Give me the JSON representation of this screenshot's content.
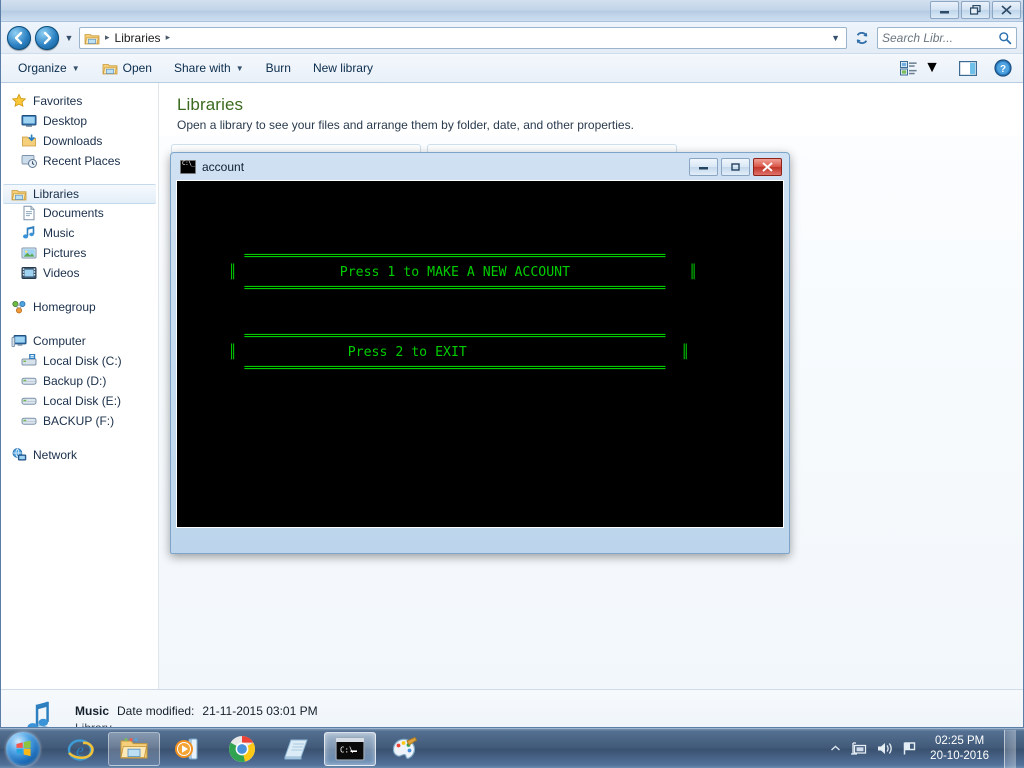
{
  "explorer": {
    "window_buttons": [
      {
        "name": "minimize",
        "glyph": "minimize-icon"
      },
      {
        "name": "restore",
        "glyph": "restore-icon"
      },
      {
        "name": "close",
        "glyph": "close-icon"
      }
    ],
    "address": {
      "crumb_icon": "library-folder-icon",
      "crumbs": [
        "Libraries"
      ],
      "separator": "▸",
      "dropdown": "▼",
      "refresh_icon": "refresh-icon"
    },
    "search": {
      "placeholder": "Search Libr...",
      "icon": "search-icon"
    },
    "commandbar": {
      "organize": "Organize",
      "open": "Open",
      "share_with": "Share with",
      "burn": "Burn",
      "new_library": "New library",
      "caret": "▼",
      "view_icon": "change-view-icon",
      "preview_icon": "preview-pane-icon",
      "help_icon": "help-icon"
    },
    "sidebar": {
      "groups": [
        {
          "header": {
            "label": "Favorites",
            "icon": "star-icon",
            "level": 0
          },
          "items": [
            {
              "label": "Desktop",
              "icon": "desktop-icon",
              "level": 1
            },
            {
              "label": "Downloads",
              "icon": "downloads-icon",
              "level": 1
            },
            {
              "label": "Recent Places",
              "icon": "recent-places-icon",
              "level": 1
            }
          ]
        },
        {
          "header": {
            "label": "Libraries",
            "icon": "library-folder-icon",
            "level": 0,
            "selected": true
          },
          "items": [
            {
              "label": "Documents",
              "icon": "documents-icon",
              "level": 1
            },
            {
              "label": "Music",
              "icon": "music-icon",
              "level": 1
            },
            {
              "label": "Pictures",
              "icon": "pictures-icon",
              "level": 1
            },
            {
              "label": "Videos",
              "icon": "videos-icon",
              "level": 1
            }
          ]
        },
        {
          "header": {
            "label": "Homegroup",
            "icon": "homegroup-icon",
            "level": 0
          },
          "items": []
        },
        {
          "header": {
            "label": "Computer",
            "icon": "computer-icon",
            "level": 0
          },
          "items": [
            {
              "label": "Local Disk (C:)",
              "icon": "system-drive-icon",
              "level": 1
            },
            {
              "label": "Backup (D:)",
              "icon": "drive-icon",
              "level": 1
            },
            {
              "label": "Local Disk  (E:)",
              "icon": "drive-icon",
              "level": 1
            },
            {
              "label": "BACKUP (F:)",
              "icon": "drive-icon",
              "level": 1
            }
          ]
        },
        {
          "header": {
            "label": "Network",
            "icon": "network-icon",
            "level": 0
          },
          "items": []
        }
      ]
    },
    "content": {
      "title": "Libraries",
      "subtitle": "Open a library to see your files and arrange them by folder, date, and other properties."
    },
    "statusbar": {
      "icon": "music-library-icon",
      "name": "Music",
      "date_label": "Date modified:",
      "date_value": "21-11-2015  03:01 PM",
      "type": "Library"
    }
  },
  "console": {
    "title": "account",
    "icon": "console-icon",
    "buttons": [
      {
        "name": "minimize",
        "glyph": "minimize-icon"
      },
      {
        "name": "restore",
        "glyph": "restore-icon"
      },
      {
        "name": "close",
        "glyph": "close-icon"
      }
    ],
    "text_color": "#00cc00",
    "background_color": "#000000",
    "screen_text": "\n\n\n\n        ═════════════════════════════════════════════════════\n      ║             Press 1 to MAKE A NEW ACCOUNT               ║\n        ═════════════════════════════════════════════════════\n\n\n        ═════════════════════════════════════════════════════\n      ║              Press 2 to EXIT                           ║\n        ═════════════════════════════════════════════════════\n",
    "menu_options": [
      "Press 1 to MAKE A NEW ACCOUNT",
      "Press 2 to EXIT"
    ]
  },
  "taskbar": {
    "start_button": "start-orb",
    "items": [
      {
        "name": "internet-explorer",
        "state": "pinned"
      },
      {
        "name": "windows-explorer",
        "state": "active"
      },
      {
        "name": "windows-media-player",
        "state": "pinned"
      },
      {
        "name": "google-chrome",
        "state": "pinned"
      },
      {
        "name": "notepad",
        "state": "pinned"
      },
      {
        "name": "command-prompt",
        "state": "active"
      },
      {
        "name": "paint",
        "state": "pinned"
      }
    ],
    "tray": {
      "show_hidden": "▲",
      "icons": [
        "network-tray-icon",
        "volume-tray-icon",
        "action-center-flag-icon"
      ],
      "time": "02:25 PM",
      "date": "20-10-2016"
    }
  }
}
